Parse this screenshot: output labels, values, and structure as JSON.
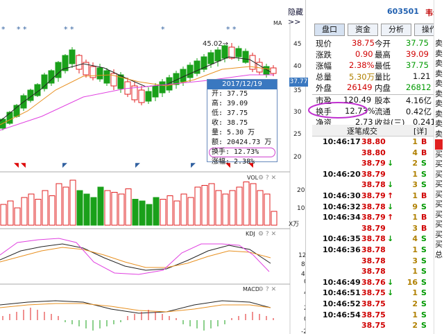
{
  "header": {
    "hide_label": "隐藏>>",
    "stock_code": "603501",
    "stock_name": "韦尔股"
  },
  "tabs": [
    "盘口",
    "资金",
    "分析",
    "操作"
  ],
  "quote_rows": [
    {
      "l1": "现价",
      "v1": "38.75",
      "l2": "今开",
      "v2": "37.75"
    },
    {
      "l1": "涨跌",
      "v1": "0.90",
      "l2": "最高",
      "v2": "39.09"
    },
    {
      "l1": "涨幅",
      "v1": "2.38%",
      "l2": "最低",
      "v2": "37.75"
    },
    {
      "l1": "总量",
      "v1": "5.30万",
      "l2": "量比",
      "v2": "1.21"
    },
    {
      "l1": "外盘",
      "v1": "26149",
      "l2": "内盘",
      "v2": "26812"
    },
    {
      "l1": "市盈",
      "v1": "120.49",
      "l2": "股本",
      "v2": "4.16亿"
    },
    {
      "l1": "换手",
      "v1": "12.73%",
      "l2": "流通",
      "v2": "0.42亿"
    },
    {
      "l1": "净资",
      "v1": "2.73",
      "l2": "收益(三)",
      "v2": "0.241"
    }
  ],
  "trade_header": {
    "title": "逐笔成交",
    "detail": "[详]"
  },
  "trades": [
    {
      "time": "10:46:17",
      "price": "38.80",
      "arrow": "",
      "vol": "1",
      "side": "B"
    },
    {
      "time": "",
      "price": "38.80",
      "arrow": "",
      "vol": "4",
      "side": "B"
    },
    {
      "time": "",
      "price": "38.79",
      "arrow": "↓",
      "vol": "2",
      "side": "S"
    },
    {
      "time": "10:46:20",
      "price": "38.79",
      "arrow": "",
      "vol": "1",
      "side": "S"
    },
    {
      "time": "",
      "price": "38.78",
      "arrow": "↓",
      "vol": "3",
      "side": "S"
    },
    {
      "time": "10:46:30",
      "price": "38.79",
      "arrow": "↑",
      "vol": "1",
      "side": "B"
    },
    {
      "time": "10:46:32",
      "price": "38.78",
      "arrow": "↓",
      "vol": "9",
      "side": "S"
    },
    {
      "time": "10:46:34",
      "price": "38.79",
      "arrow": "↑",
      "vol": "1",
      "side": "B"
    },
    {
      "time": "",
      "price": "38.79",
      "arrow": "",
      "vol": "3",
      "side": "B"
    },
    {
      "time": "10:46:35",
      "price": "38.78",
      "arrow": "↓",
      "vol": "4",
      "side": "S"
    },
    {
      "time": "10:46:36",
      "price": "38.78",
      "arrow": "",
      "vol": "1",
      "side": "S"
    },
    {
      "time": "",
      "price": "38.78",
      "arrow": "",
      "vol": "3",
      "side": "S"
    },
    {
      "time": "",
      "price": "38.78",
      "arrow": "",
      "vol": "1",
      "side": "S"
    },
    {
      "time": "10:46:49",
      "price": "38.76",
      "arrow": "↓",
      "vol": "16",
      "side": "S"
    },
    {
      "time": "10:46:51",
      "price": "38.75",
      "arrow": "↓",
      "vol": "1",
      "side": "S"
    },
    {
      "time": "10:46:52",
      "price": "38.75",
      "arrow": "",
      "vol": "2",
      "side": "S"
    },
    {
      "time": "10:46:54",
      "price": "38.75",
      "arrow": "",
      "vol": "1",
      "side": "S"
    },
    {
      "time": "",
      "price": "38.75",
      "arrow": "",
      "vol": "2",
      "side": "S"
    }
  ],
  "tooltip": {
    "date": "2017/12/19",
    "lines": [
      "开: 37.75",
      "高: 39.09",
      "低: 37.75",
      "收: 38.75",
      "量: 5.30 万",
      "额: 20424.73 万",
      "换手: 12.73%",
      "涨幅: 2.38%"
    ]
  },
  "chart_labels": {
    "ma": "MA",
    "vol": "VOL",
    "kdj": "KDJ",
    "macd": "MACD",
    "high_marker": "45.02→",
    "current_price": "37.77",
    "vol_unit": "X万",
    "price_axis": [
      "45",
      "40",
      "35",
      "30",
      "25",
      "20"
    ],
    "vol_axis": [
      "20",
      "10"
    ],
    "kdj_axis": [
      "120",
      "80",
      "40",
      "0"
    ],
    "macd_axis": [
      "4",
      "2",
      "0",
      "-2"
    ]
  },
  "side_chars": [
    "卖",
    "卖",
    "卖",
    "卖",
    "卖",
    "卖",
    "卖",
    "卖",
    "卖",
    "卖",
    "",
    "买",
    "买",
    "买",
    "买",
    "买",
    "买",
    "买",
    "买",
    "买",
    "买",
    "总"
  ],
  "colors": {
    "up": "#e02020",
    "down": "#1aa01a",
    "accent": "#3a78c0",
    "highlight": "#e040e0"
  }
}
